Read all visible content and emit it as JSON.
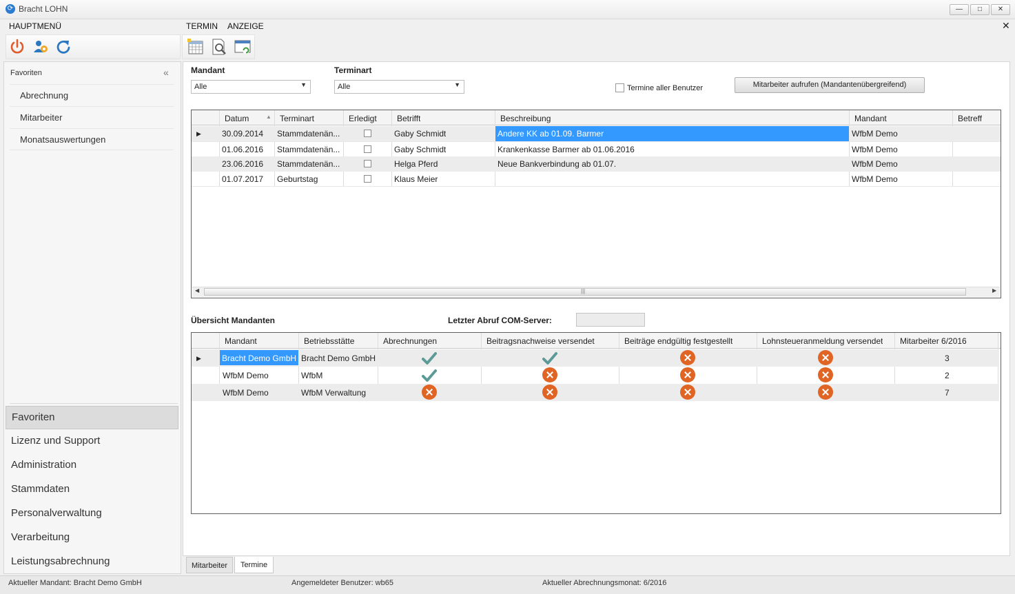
{
  "window": {
    "title": "Bracht LOHN",
    "minimize": "—",
    "maximize": "□",
    "close": "✕",
    "doc_close": "✕"
  },
  "menu": [
    "HAUPTMENÜ",
    "TERMIN",
    "ANZEIGE"
  ],
  "sidebar": {
    "header": "Favoriten",
    "favorites": [
      "Abrechnung",
      "Mitarbeiter",
      "Monatsauswertungen"
    ],
    "sections": [
      "Favoriten",
      "Lizenz und Support",
      "Administration",
      "Stammdaten",
      "Personalverwaltung",
      "Verarbeitung",
      "Leistungsabrechnung"
    ]
  },
  "filters": {
    "mandant_label": "Mandant",
    "mandant_value": "Alle",
    "terminart_label": "Terminart",
    "terminart_value": "Alle",
    "all_users_label": "Termine aller Benutzer",
    "all_users_checked": false,
    "call_employee_button": "Mitarbeiter aufrufen (Mandantenübergreifend)"
  },
  "appointments": {
    "columns": [
      "Datum",
      "Terminart",
      "Erledigt",
      "Betrifft",
      "Beschreibung",
      "Mandant",
      "Betreff"
    ],
    "rows": [
      {
        "datum": "30.09.2014",
        "terminart": "Stammdatenän...",
        "erledigt": false,
        "betrifft": "Gaby Schmidt",
        "beschreibung": "Andere KK ab 01.09. Barmer",
        "mandant": "WfbM Demo",
        "betreff": ""
      },
      {
        "datum": "01.06.2016",
        "terminart": "Stammdatenän...",
        "erledigt": false,
        "betrifft": "Gaby Schmidt",
        "beschreibung": "Krankenkasse Barmer ab 01.06.2016",
        "mandant": "WfbM Demo",
        "betreff": ""
      },
      {
        "datum": "23.06.2016",
        "terminart": "Stammdatenän...",
        "erledigt": false,
        "betrifft": "Helga Pferd",
        "beschreibung": "Neue Bankverbindung ab 01.07.",
        "mandant": "WfbM Demo",
        "betreff": ""
      },
      {
        "datum": "01.07.2017",
        "terminart": "Geburtstag",
        "erledigt": false,
        "betrifft": "Klaus Meier",
        "beschreibung": "",
        "mandant": "WfbM Demo",
        "betreff": ""
      }
    ]
  },
  "overview": {
    "title": "Übersicht Mandanten",
    "com_server_label": "Letzter Abruf COM-Server:",
    "com_server_value": "",
    "columns": [
      "Mandant",
      "Betriebsstätte",
      "Abrechnungen",
      "Beitragsnachweise versendet",
      "Beiträge endgültig festgestellt",
      "Lohnsteueranmeldung versendet",
      "Mitarbeiter 6/2016"
    ],
    "rows": [
      {
        "mandant": "Bracht Demo GmbH",
        "betriebsstaette": "Bracht Demo GmbH",
        "abrechnungen": true,
        "beitragsnachweise": true,
        "beitraege": false,
        "lohnsteuer": false,
        "mitarbeiter": "3"
      },
      {
        "mandant": "WfbM Demo",
        "betriebsstaette": "WfbM",
        "abrechnungen": true,
        "beitragsnachweise": false,
        "beitraege": false,
        "lohnsteuer": false,
        "mitarbeiter": "2"
      },
      {
        "mandant": "WfbM Demo",
        "betriebsstaette": "WfbM Verwaltung",
        "abrechnungen": false,
        "beitragsnachweise": false,
        "beitraege": false,
        "lohnsteuer": false,
        "mitarbeiter": "7"
      }
    ]
  },
  "tabs": [
    "Mitarbeiter",
    "Termine"
  ],
  "status": {
    "mandant": "Aktueller Mandant: Bracht Demo GmbH",
    "benutzer": "Angemeldeter Benutzer: wb65",
    "monat": "Aktueller Abrechnungsmonat: 6/2016"
  },
  "colors": {
    "accent": "#3399ff",
    "ok": "#5b9a96",
    "error": "#e06424",
    "power": "#e05a2a",
    "refresh": "#2a78c2"
  }
}
